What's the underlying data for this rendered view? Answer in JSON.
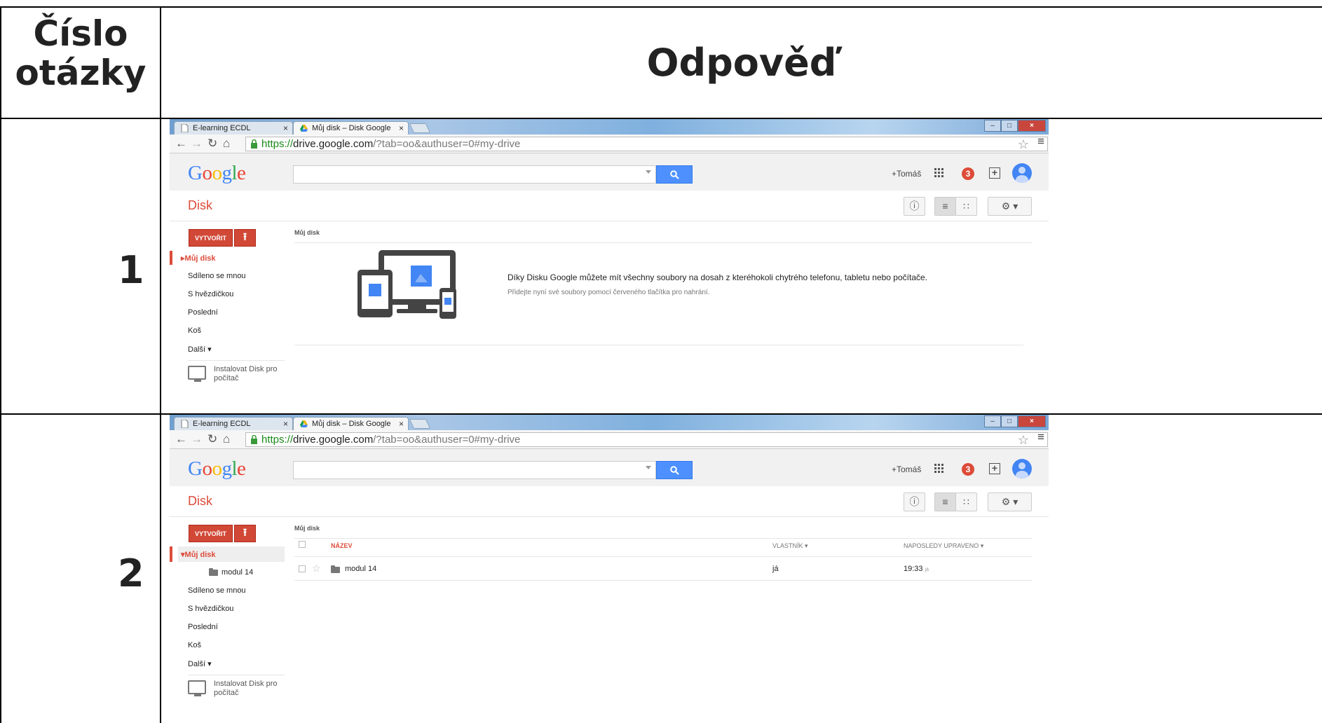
{
  "header": {
    "col1_line1": "Číslo",
    "col1_line2": "otázky",
    "col2": "Odpověď"
  },
  "rows": [
    {
      "number": "1",
      "browser": {
        "tabs": [
          "E-learning ECDL",
          "Můj disk – Disk Google"
        ],
        "url_https": "https://",
        "url_host": "drive.google.com",
        "url_rest": "/?tab=oo&authuser=0#my-drive"
      },
      "google_header": {
        "logo": "Google",
        "user": "+Tomáš",
        "notifications": "3"
      },
      "drive": {
        "title": "Disk",
        "create_label": "VYTVOŘIT",
        "sidebar": [
          "Můj disk",
          "Sdíleno se mnou",
          "S hvězdičkou",
          "Poslední",
          "Koš",
          "Další ▾"
        ],
        "install_line1": "Instalovat Disk pro",
        "install_line2": "počítač",
        "breadcrumb": "Můj disk",
        "empty_message": "Díky Disku Google můžete mít všechny soubory na dosah z kteréhokoli chytrého telefonu, tabletu nebo počítače.",
        "empty_sub": "Přidejte nyní své soubory pomocí červeného tlačítka pro nahrání."
      }
    },
    {
      "number": "2",
      "browser": {
        "tabs": [
          "E-learning ECDL",
          "Můj disk – Disk Google"
        ],
        "url_https": "https://",
        "url_host": "drive.google.com",
        "url_rest": "/?tab=oo&authuser=0#my-drive"
      },
      "google_header": {
        "logo": "Google",
        "user": "+Tomáš",
        "notifications": "3"
      },
      "drive": {
        "title": "Disk",
        "create_label": "VYTVOŘIT",
        "sidebar": [
          "Můj disk",
          "Sdíleno se mnou",
          "S hvězdičkou",
          "Poslední",
          "Koš",
          "Další ▾"
        ],
        "subfolder": "modul 14",
        "install_line1": "Instalovat Disk pro",
        "install_line2": "počítač",
        "breadcrumb": "Můj disk",
        "columns": [
          "NÁZEV",
          "VLASTNÍK",
          "NAPOSLEDY UPRAVENO"
        ],
        "files": [
          {
            "name": "modul 14",
            "owner": "já",
            "modified": "19:33",
            "modified_by": "já"
          }
        ]
      }
    }
  ],
  "colors": {
    "accent_red": "#dd4b39",
    "search_blue": "#4d90fe"
  }
}
